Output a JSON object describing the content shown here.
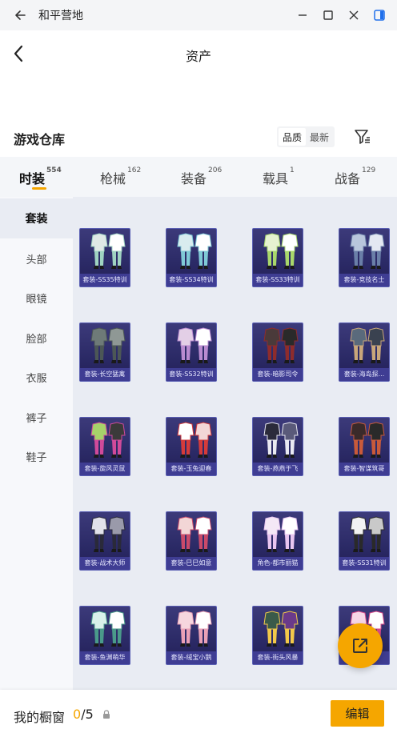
{
  "window": {
    "title": "和平营地"
  },
  "header": {
    "title": "资产"
  },
  "section": {
    "title": "游戏仓库"
  },
  "sort": {
    "options": [
      "品质",
      "最新"
    ],
    "selected": "品质"
  },
  "tabs": [
    {
      "label": "时装",
      "count": "554",
      "active": true
    },
    {
      "label": "枪械",
      "count": "162"
    },
    {
      "label": "装备",
      "count": "206"
    },
    {
      "label": "载具",
      "count": "1"
    },
    {
      "label": "战备",
      "count": "129"
    }
  ],
  "sidebar": {
    "items": [
      {
        "label": "套装",
        "active": true
      },
      {
        "label": "头部"
      },
      {
        "label": "眼镜"
      },
      {
        "label": "脸部"
      },
      {
        "label": "衣服"
      },
      {
        "label": "裤子"
      },
      {
        "label": "鞋子"
      }
    ]
  },
  "grid": {
    "items": [
      {
        "label": "套装-SS35特训",
        "colors": [
          "#dfe9e6",
          "#9fd3c1",
          "#ffffff"
        ]
      },
      {
        "label": "套装-SS34特训",
        "colors": [
          "#d9ecef",
          "#7fc9d6",
          "#ffffff"
        ]
      },
      {
        "label": "套装-SS33特训",
        "colors": [
          "#e6f2d0",
          "#a9d86b",
          "#ffffff"
        ]
      },
      {
        "label": "套装-竞技名士",
        "colors": [
          "#b8c6dc",
          "#6a7fa8",
          "#e3e8f2"
        ]
      },
      {
        "label": "套装-长空猛禽",
        "colors": [
          "#6e7a78",
          "#4c5756",
          "#8f9895"
        ]
      },
      {
        "label": "套装-SS32特训",
        "colors": [
          "#e3cfe6",
          "#b98bd0",
          "#ffffff"
        ]
      },
      {
        "label": "套装-暗影司令",
        "colors": [
          "#4a3a3a",
          "#8e2c2c",
          "#2a2a2a"
        ]
      },
      {
        "label": "套装-海岛探...",
        "colors": [
          "#5a6a7c",
          "#c9a67a",
          "#3a4250"
        ]
      },
      {
        "label": "套装-旋风灵鼠",
        "colors": [
          "#a7d26a",
          "#d04a9a",
          "#3a3a3a"
        ]
      },
      {
        "label": "套装-玉兔迎春",
        "colors": [
          "#ffffff",
          "#d43b3b",
          "#f2d6d6"
        ]
      },
      {
        "label": "套装-燕燕于飞",
        "colors": [
          "#2b2b3b",
          "#e9e9f2",
          "#5a5a7a"
        ]
      },
      {
        "label": "套装-智谋筑哥",
        "colors": [
          "#3a2a2a",
          "#c95a3a",
          "#2a2a2a"
        ]
      },
      {
        "label": "套装-战术大师",
        "colors": [
          "#e2e2ea",
          "#2a2a3a",
          "#9a9aaa"
        ]
      },
      {
        "label": "套装-巳巳如意",
        "colors": [
          "#f2d6d6",
          "#c94a6a",
          "#ffffff"
        ]
      },
      {
        "label": "角色-都市丽猫",
        "colors": [
          "#f4e8f6",
          "#e9c6f0",
          "#ffffff"
        ]
      },
      {
        "label": "套装-SS31特训",
        "colors": [
          "#f2f2f2",
          "#2a2a2a",
          "#c9c9c9"
        ]
      },
      {
        "label": "套装-鱼渊萌华",
        "colors": [
          "#d9f2ea",
          "#4a9a8a",
          "#ffffff"
        ]
      },
      {
        "label": "套装-绒宝小鹅",
        "colors": [
          "#f6d6de",
          "#e9a0b6",
          "#ffffff"
        ]
      },
      {
        "label": "套装-街头风暴",
        "colors": [
          "#3a5a4a",
          "#f2c94a",
          "#6a3a8a"
        ]
      },
      {
        "label": "套装-...",
        "colors": [
          "#f6d6e6",
          "#d94a8a",
          "#ffffff"
        ]
      }
    ]
  },
  "bottom": {
    "label": "我的橱窗",
    "current": "0",
    "total": "/5",
    "edit_label": "编辑"
  },
  "colors": {
    "accent": "#f5a600",
    "tab_bg": "#f4f6f9",
    "grid_bg": "#e9ecf3",
    "card_bg": "#2b2a66",
    "card_border": "#5a5fb3"
  }
}
